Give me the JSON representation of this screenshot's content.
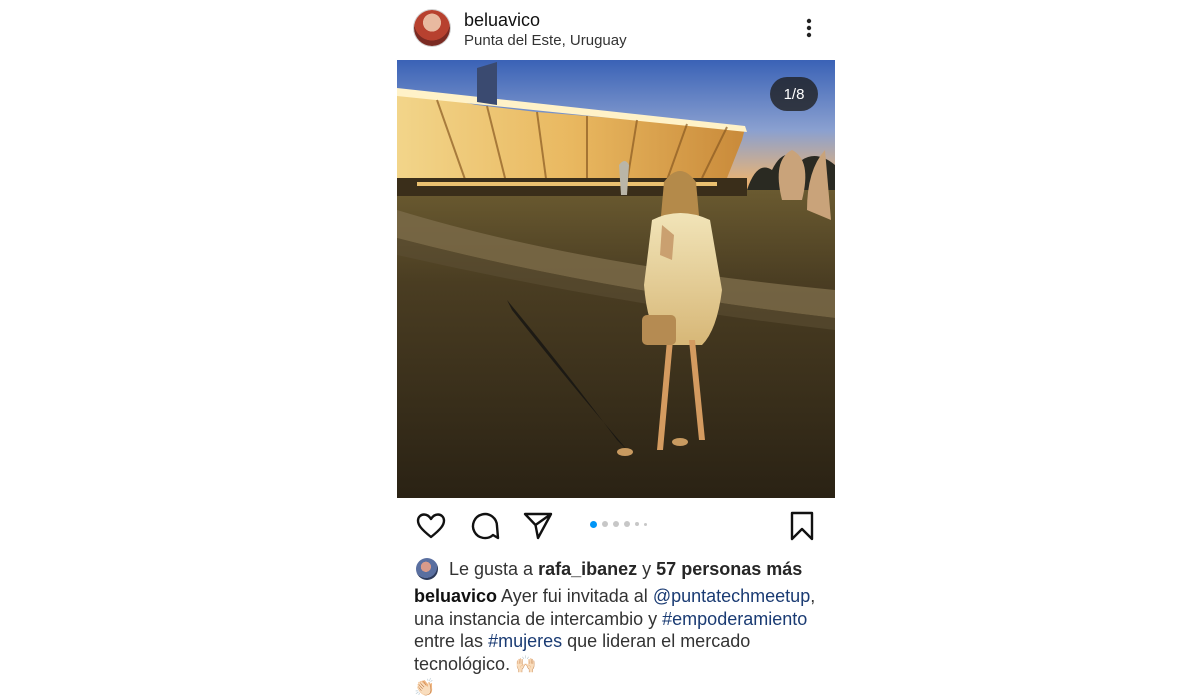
{
  "header": {
    "username": "beluavico",
    "location": "Punta del Este, Uruguay",
    "more_icon": "more-vertical-icon"
  },
  "photo": {
    "counter": "1/8",
    "description_icon": "photo"
  },
  "actions": {
    "icons": [
      "heart-icon",
      "comment-icon",
      "send-icon",
      "bookmark-icon"
    ],
    "carousel_dots": 6,
    "active_dot": 0,
    "accent_color": "#0095f6"
  },
  "likes": {
    "prefix": "Le gusta a",
    "user": "rafa_ibanez",
    "connector": "y",
    "others": "57 personas más"
  },
  "caption": {
    "username": "beluavico",
    "text_1": "Ayer fui invitada al",
    "mention": "@puntatechmeetup",
    "text_2": ", una instancia de intercambio y",
    "hashtag_1": "#empoderamiento",
    "text_3": "entre las",
    "hashtag_2": "#mujeres",
    "text_4": "que lideran el mercado tecnológico.",
    "emoji_1": "🙌🏻",
    "emoji_2": "👏🏻"
  }
}
